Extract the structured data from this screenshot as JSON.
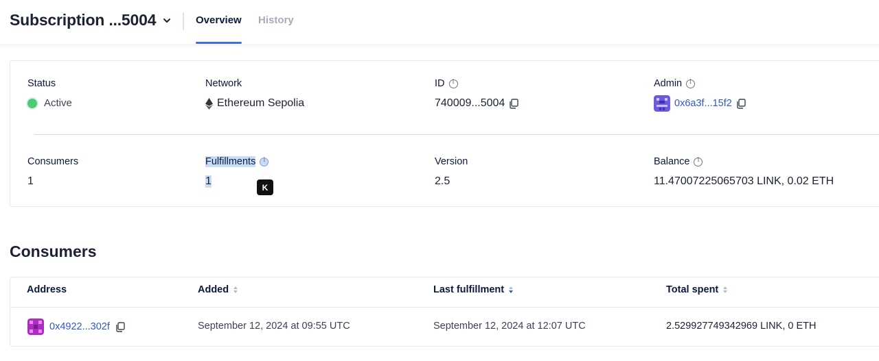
{
  "header": {
    "title": "Subscription ...5004",
    "tabs": [
      {
        "label": "Overview",
        "active": true
      },
      {
        "label": "History",
        "active": false
      }
    ]
  },
  "details": {
    "status": {
      "label": "Status",
      "value": "Active",
      "color": "#4ec977"
    },
    "network": {
      "label": "Network",
      "value": "Ethereum Sepolia",
      "icon": "ethereum-icon"
    },
    "id": {
      "label": "ID",
      "value": "740009...5004"
    },
    "admin": {
      "label": "Admin",
      "value": "0x6a3f...15f2"
    },
    "consumers": {
      "label": "Consumers",
      "value": "1"
    },
    "fulfillments": {
      "label": "Fulfillments",
      "value": "1"
    },
    "version": {
      "label": "Version",
      "value": "2.5"
    },
    "balance": {
      "label": "Balance",
      "value": "11.47007225065703 LINK, 0.02 ETH"
    }
  },
  "badge": {
    "text": "K"
  },
  "consumers_section": {
    "title": "Consumers",
    "columns": [
      "Address",
      "Added",
      "Last fulfillment",
      "Total spent"
    ],
    "rows": [
      {
        "address": "0x4922...302f",
        "added": "September 12, 2024 at 09:55 UTC",
        "last_fulfillment": "September 12, 2024 at 12:07 UTC",
        "total_spent": "2.529927749342969 LINK, 0 ETH"
      }
    ]
  },
  "colors": {
    "accent": "#3d6fe0",
    "link": "#2f56d6"
  }
}
